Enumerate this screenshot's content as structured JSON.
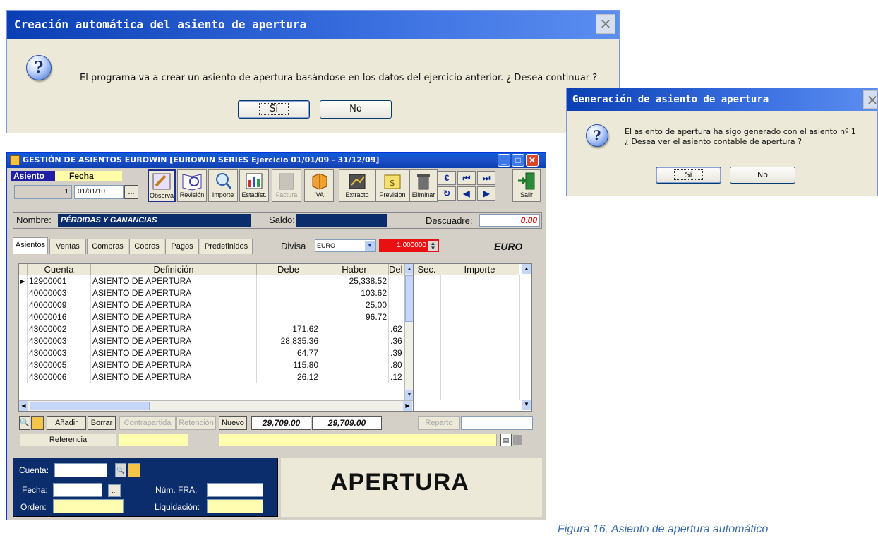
{
  "dialog1": {
    "title": "Creación automática del asiento de apertura",
    "message": "El programa va a crear un asiento de apertura basándose en los datos del ejercicio anterior. ¿ Desea continuar ?",
    "yes_label": "Sí",
    "no_label": "No",
    "close_glyph": "✕"
  },
  "dialog2": {
    "title": "Generación de asiento de apertura",
    "message_line1": "El asiento de apertura ha sigo generado con el asiento nº 1",
    "message_line2": "¿ Desea ver el asiento contable de apertura ?",
    "yes_label": "Sí",
    "no_label": "No"
  },
  "main": {
    "title": "GESTIÓN DE ASIENTOS EUROWIN  [EUROWIN SERIES Ejercicio 01/01/09 - 31/12/09]",
    "asiento_label": "Asiento",
    "fecha_label": "Fecha",
    "asiento_value": "1",
    "fecha_value": "01/01/10",
    "ellipsis": "...",
    "toolbar": [
      "Observa",
      "Revisión",
      "Importe",
      "Estadíst.",
      "Factura",
      "IVA",
      "Extracto",
      "Prevision",
      "Eliminar"
    ],
    "toolbar_disabled": [
      "Factura"
    ],
    "salir_label": "Salir",
    "euro_glyph": "€",
    "nombre_label": "Nombre:",
    "nombre_value": "PÉRDIDAS Y GANANCIAS",
    "saldo_label": "Saldo:",
    "descuadre_label": "Descuadre:",
    "descuadre_value": "0.00",
    "tabs": [
      "Asientos",
      "Ventas",
      "Compras",
      "Cobros",
      "Pagos",
      "Predefinidos"
    ],
    "divisa_label": "Divisa",
    "divisa_value": "EURO",
    "rate_value": "1.000000",
    "currency_label": "EURO",
    "grid": {
      "headers": [
        "Cuenta",
        "Definición",
        "Debe",
        "Haber",
        "Del"
      ],
      "rows": [
        {
          "cuenta": "12900001",
          "definicion": "ASIENTO DE APERTURA",
          "debe": "",
          "haber": "25,338.52",
          "del": ""
        },
        {
          "cuenta": "40000003",
          "definicion": "ASIENTO DE APERTURA",
          "debe": "",
          "haber": "103.62",
          "del": ""
        },
        {
          "cuenta": "40000009",
          "definicion": "ASIENTO DE APERTURA",
          "debe": "",
          "haber": "25.00",
          "del": ""
        },
        {
          "cuenta": "40000016",
          "definicion": "ASIENTO DE APERTURA",
          "debe": "",
          "haber": "96.72",
          "del": ""
        },
        {
          "cuenta": "43000002",
          "definicion": "ASIENTO DE APERTURA",
          "debe": "171.62",
          "haber": "",
          "del": ".62"
        },
        {
          "cuenta": "43000003",
          "definicion": "ASIENTO DE APERTURA",
          "debe": "28,835.36",
          "haber": "",
          "del": ".36"
        },
        {
          "cuenta": "43000003",
          "definicion": "ASIENTO DE APERTURA",
          "debe": "64.77",
          "haber": "",
          "del": ".39"
        },
        {
          "cuenta": "43000005",
          "definicion": "ASIENTO DE APERTURA",
          "debe": "115.80",
          "haber": "",
          "del": ".80"
        },
        {
          "cuenta": "43000006",
          "definicion": "ASIENTO DE APERTURA",
          "debe": "26.12",
          "haber": "",
          "del": ".12"
        }
      ]
    },
    "grid2_headers": [
      "Sec.",
      "Importe"
    ],
    "bottom_buttons": {
      "anadir": "Añadir",
      "borrar": "Borrar",
      "contrapartida": "Contrapartida",
      "retencion": "Retención",
      "nuevo": "Nuevo",
      "reparto": "Reparto",
      "referencia": "Referencia"
    },
    "total_debe": "29,709.00",
    "total_haber": "29,709.00",
    "panel": {
      "cuenta_label": "Cuenta:",
      "fecha_label": "Fecha:",
      "orden_label": "Orden:",
      "num_fra_label": "Núm. FRA:",
      "liquidacion_label": "Liquidación:"
    },
    "big_label": "APERTURA"
  },
  "caption": "Figura 16. Asiento de apertura automático"
}
